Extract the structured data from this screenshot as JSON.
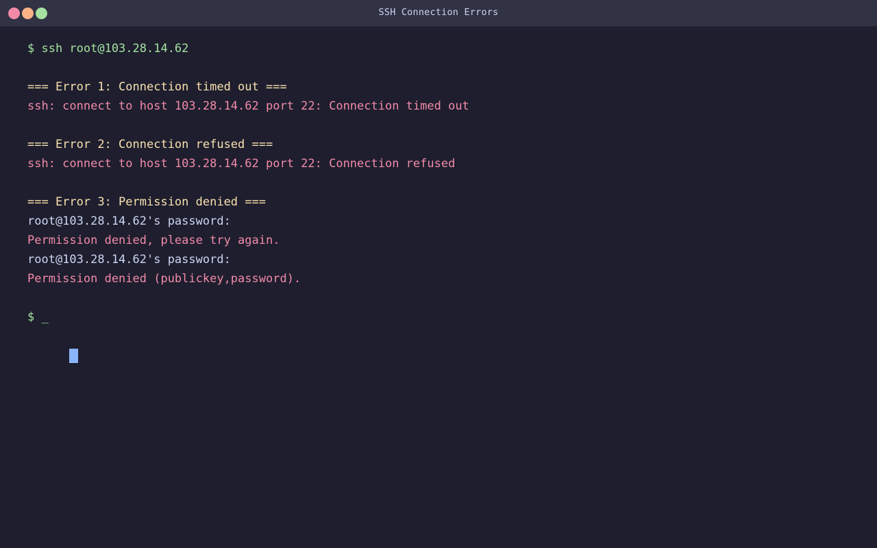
{
  "window": {
    "title": "SSH Connection Errors",
    "buttons": {
      "close_color": "#f38ba8",
      "minimize_color": "#fab387",
      "maximize_color": "#a6e3a1"
    }
  },
  "colors": {
    "background": "#1e1e2e",
    "prompt": "#a6e3a1",
    "header": "#f9e2af",
    "error": "#f38ba8",
    "normal": "#cdd6f4",
    "cursor": "#89b4fa"
  },
  "terminal": {
    "command": "$ ssh root@103.28.14.62",
    "error1_header": "=== Error 1: Connection timed out ===",
    "error1_message": "ssh: connect to host 103.28.14.62 port 22: Connection timed out",
    "error2_header": "=== Error 2: Connection refused ===",
    "error2_message": "ssh: connect to host 103.28.14.62 port 22: Connection refused",
    "error3_header": "=== Error 3: Permission denied ===",
    "password_prompt_1": "root@103.28.14.62's password:",
    "permission_denied_1": "Permission denied, please try again.",
    "password_prompt_2": "root@103.28.14.62's password:",
    "permission_denied_2": "Permission denied (publickey,password).",
    "final_prompt": "$ _"
  }
}
